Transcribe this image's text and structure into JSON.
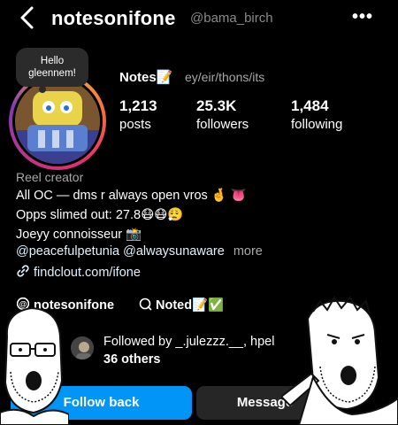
{
  "header": {
    "username": "notesonifone",
    "watermark": "@bama_birch",
    "more": "•••"
  },
  "note": {
    "text_line1": "Hello",
    "text_line2": "gleennem!"
  },
  "profile": {
    "name": "Notes",
    "name_emoji": "📝",
    "pronouns": "ey/eir/thons/its",
    "stats": [
      {
        "value": "1,213",
        "label": "posts"
      },
      {
        "value": "25.3K",
        "label": "followers"
      },
      {
        "value": "1,484",
        "label": "following"
      }
    ]
  },
  "bio": {
    "category": "Reel creator",
    "line1": "All OC — dms r always open vros",
    "line1_emoji": "🤞 👅",
    "line2": "Opps slimed out: 27.8",
    "line2_emoji": "😷😷😮‍💨",
    "line3": "Joeyy connoisseur",
    "line3_emoji": "📸",
    "mentions": "@peacefulpetunia @alwaysunaware",
    "more": "more",
    "link": "findclout.com/ifone"
  },
  "badges": {
    "threads": "notesonifone",
    "notes": "Noted",
    "notes_emoji": "📝✅"
  },
  "followed_by": {
    "line1": "Followed by _.julezzz.__, hpel",
    "line2": "36 others"
  },
  "actions": {
    "follow_back": "Follow back",
    "message": "Message"
  },
  "icons": {
    "back": "chevron-left-icon",
    "link": "link-icon",
    "threads": "threads-icon",
    "notes": "search-note-icon"
  }
}
